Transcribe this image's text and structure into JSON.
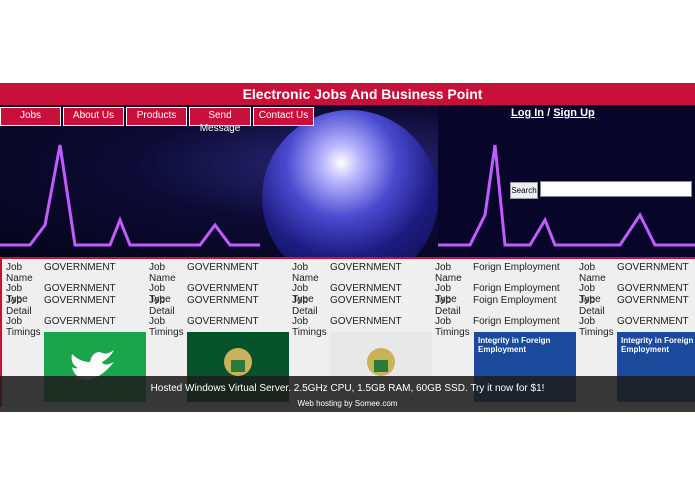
{
  "site": {
    "title": "Electronic Jobs And Business Point"
  },
  "nav": {
    "items": [
      {
        "label": "Jobs"
      },
      {
        "label": "About Us"
      },
      {
        "label": "Products"
      },
      {
        "label": "Send Message"
      },
      {
        "label": "Contact Us"
      }
    ]
  },
  "auth": {
    "login": "Log In",
    "sep": "/",
    "signup": "Sign Up"
  },
  "search": {
    "button": "Search"
  },
  "jobs": [
    {
      "name_label": "Job Name",
      "name": "GOVERNMENT",
      "type_label": "Job Type",
      "type": "GOVERNMENT",
      "detail_label": "Job Detail",
      "detail": "GOVERNMENT",
      "timings_label": "Job Timings",
      "timings": "GOVERNMENT"
    },
    {
      "name_label": "Job Name",
      "name": "GOVERNMENT",
      "type_label": "Job Type",
      "type": "GOVERNMENT",
      "detail_label": "Job Detail",
      "detail": "GOVERNMENT",
      "timings_label": "Job Timings",
      "timings": "GOVERNMENT"
    },
    {
      "name_label": "Job Name",
      "name": "GOVERNMENT",
      "type_label": "Job Type",
      "type": "GOVERNMENT",
      "detail_label": "Job Detail",
      "detail": "GOVERNMENT",
      "timings_label": "Job Timings",
      "timings": "GOVERNMENT"
    },
    {
      "name_label": "Job Name",
      "name": "Forign Employment",
      "type_label": "Job Type",
      "type": "Forign Employment",
      "detail_label": "Job Detail",
      "detail": "Foign Employment",
      "timings_label": "Job Timings",
      "timings": "Forign Employment"
    },
    {
      "name_label": "Job Name",
      "name": "GOVERNMENT",
      "type_label": "Job Type",
      "type": "GOVERNMENT",
      "detail_label": "Job Detail",
      "detail": "GOVERNMENT",
      "timings_label": "Job Timings",
      "timings": "GOVERNMENT"
    }
  ],
  "thumbs": [
    {
      "icon": "twitter-logo",
      "color": "#1aa54a"
    },
    {
      "icon": "government-emblem",
      "color": "#06522b"
    },
    {
      "icon": "government-emblem",
      "color": "#e8e8e8"
    },
    {
      "text": "Integrity in Foreign Employment",
      "color": "#1b4a9c"
    },
    {
      "text": "Integrity in Foreign Employment",
      "color": "#1b4a9c"
    }
  ],
  "ad": {
    "line1": "Hosted Windows Virtual Server. 2.5GHz CPU, 1.5GB RAM, 60GB SSD. Try it now for $1!",
    "line2": "Web hosting by Somee.com"
  }
}
